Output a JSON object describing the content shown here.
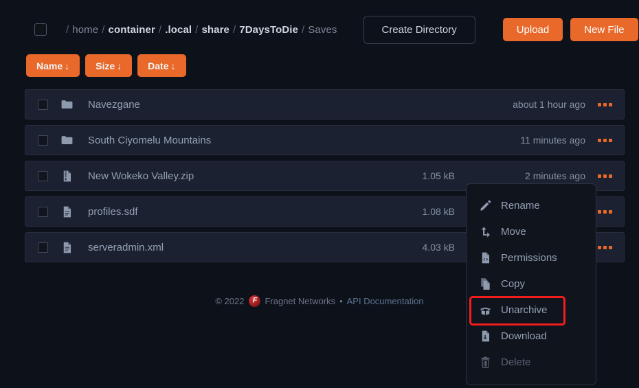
{
  "header": {
    "select_all_name": "select-all-checkbox",
    "breadcrumb": [
      {
        "label": "home",
        "strong": false
      },
      {
        "label": "container",
        "strong": true
      },
      {
        "label": ".local",
        "strong": true
      },
      {
        "label": "share",
        "strong": true
      },
      {
        "label": "7DaysToDie",
        "strong": true
      },
      {
        "label": "Saves",
        "strong": false
      }
    ],
    "separator": "/",
    "create_directory_label": "Create Directory",
    "upload_label": "Upload",
    "new_file_label": "New File"
  },
  "sort": {
    "buttons": [
      {
        "label": "Name",
        "arrow": "↓"
      },
      {
        "label": "Size",
        "arrow": "↓"
      },
      {
        "label": "Date",
        "arrow": "↓"
      }
    ]
  },
  "files": [
    {
      "name": "Navezgane",
      "icon": "folder-icon",
      "size": "",
      "date": "about 1 hour ago"
    },
    {
      "name": "South Ciyomelu Mountains",
      "icon": "folder-icon",
      "size": "",
      "date": "11 minutes ago"
    },
    {
      "name": "New Wokeko Valley.zip",
      "icon": "file-archive-icon",
      "size": "1.05 kB",
      "date": "2 minutes ago"
    },
    {
      "name": "profiles.sdf",
      "icon": "file-icon",
      "size": "1.08 kB",
      "date": ""
    },
    {
      "name": "serveradmin.xml",
      "icon": "file-icon",
      "size": "4.03 kB",
      "date": ""
    }
  ],
  "context_menu": {
    "items": [
      {
        "label": "Rename",
        "icon": "pencil-icon",
        "disabled": false,
        "highlighted": false
      },
      {
        "label": "Move",
        "icon": "arrow-move-icon",
        "disabled": false,
        "highlighted": false
      },
      {
        "label": "Permissions",
        "icon": "file-code-icon",
        "disabled": false,
        "highlighted": false
      },
      {
        "label": "Copy",
        "icon": "copy-icon",
        "disabled": false,
        "highlighted": false
      },
      {
        "label": "Unarchive",
        "icon": "box-open-icon",
        "disabled": false,
        "highlighted": true
      },
      {
        "label": "Download",
        "icon": "file-download-icon",
        "disabled": false,
        "highlighted": false
      },
      {
        "label": "Delete",
        "icon": "trash-icon",
        "disabled": true,
        "highlighted": false
      }
    ]
  },
  "footer": {
    "copyright": "© 2022",
    "logo_name": "fragnet-logo-icon",
    "logo_glyph": "F",
    "brand": "Fragnet Networks",
    "dot": "•",
    "api_link": "API Documentation"
  },
  "colors": {
    "accent": "#e8692a",
    "page_bg": "#0d111a",
    "row_bg": "#1b2130",
    "menu_bg": "#10141d",
    "highlight": "#f41d1d",
    "text": "#93a0b4"
  }
}
